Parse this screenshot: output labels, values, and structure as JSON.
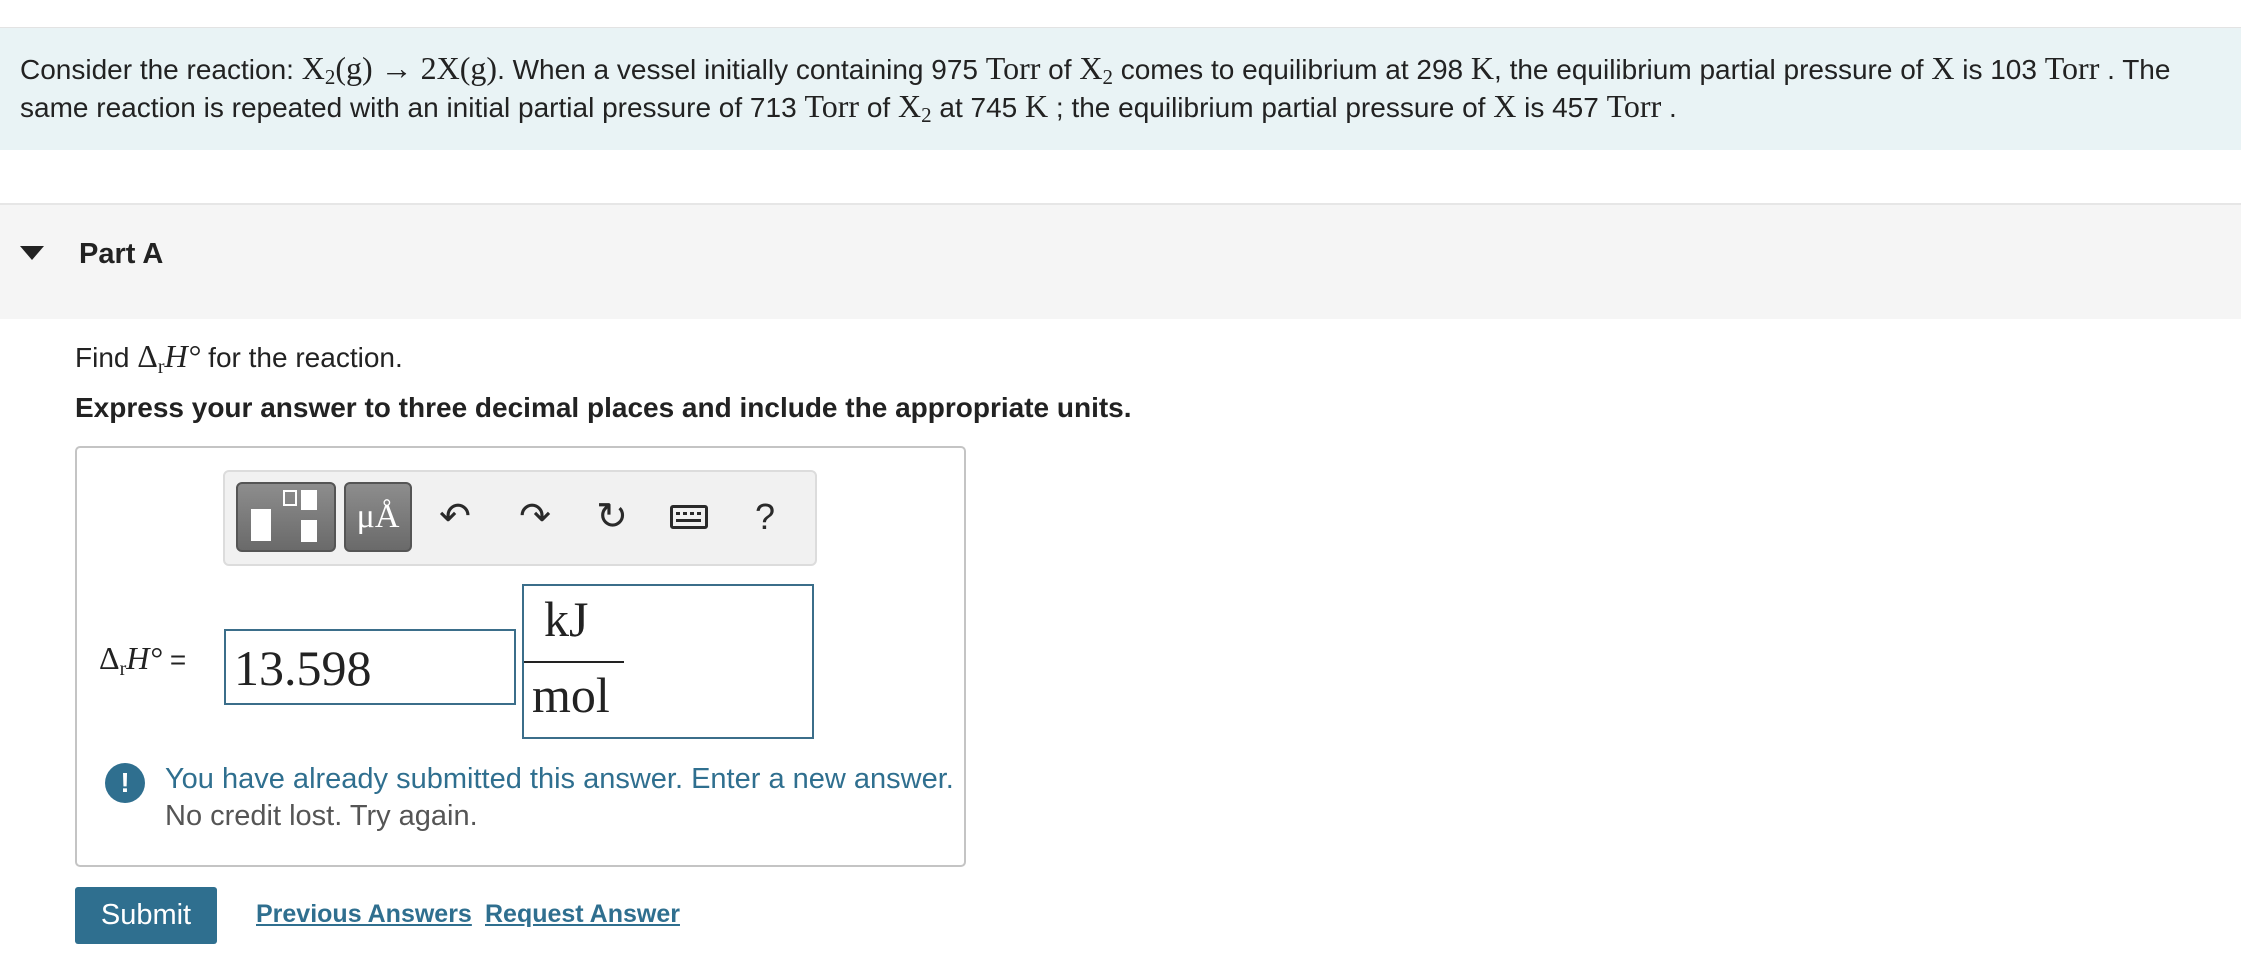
{
  "problem": {
    "t1": "Consider the reaction: ",
    "reaction_x2": "X",
    "reaction_sub1": "2",
    "reaction_rest": "(g) → 2X(g)",
    "t2": ". When a vessel initially containing 975 ",
    "unit_torr": "Torr",
    "t3": " of ",
    "x2_name": "X",
    "x2_sub": "2",
    "t4": " comes to equilibrium at 298 ",
    "unit_k": "K",
    "t5": ", the equilibrium partial pressure of ",
    "x_name": "X",
    "t6": " is 103 ",
    "t7": " . The same reaction is repeated with an initial partial pressure of 713 ",
    "t8": " of ",
    "t9": " at 745 ",
    "t10": " ; the equilibrium partial pressure of ",
    "t11": " is 457 ",
    "t12": " ."
  },
  "part": {
    "title": "Part A",
    "find_prefix": "Find ",
    "delta": "Δ",
    "delta_sub": "r",
    "h_symbol": "H°",
    "find_suffix": " for the reaction.",
    "instructions": "Express your answer to three decimal places and include the appropriate units."
  },
  "toolbar": {
    "units_label": "μÅ",
    "undo_glyph": "↶",
    "redo_glyph": "↷",
    "reset_glyph": "↻",
    "help_label": "?"
  },
  "answer": {
    "var_delta": "Δ",
    "var_sub": "r",
    "var_h": "H°",
    "equals": " =",
    "value": "13.598",
    "unit_numerator": "kJ",
    "unit_denominator": "mol"
  },
  "feedback": {
    "icon": "!",
    "line1": "You have already submitted this answer. Enter a new answer.",
    "line2": "No credit lost. Try again."
  },
  "actions": {
    "submit": "Submit",
    "previous_answers": "Previous Answers",
    "request_answer": "Request Answer"
  }
}
